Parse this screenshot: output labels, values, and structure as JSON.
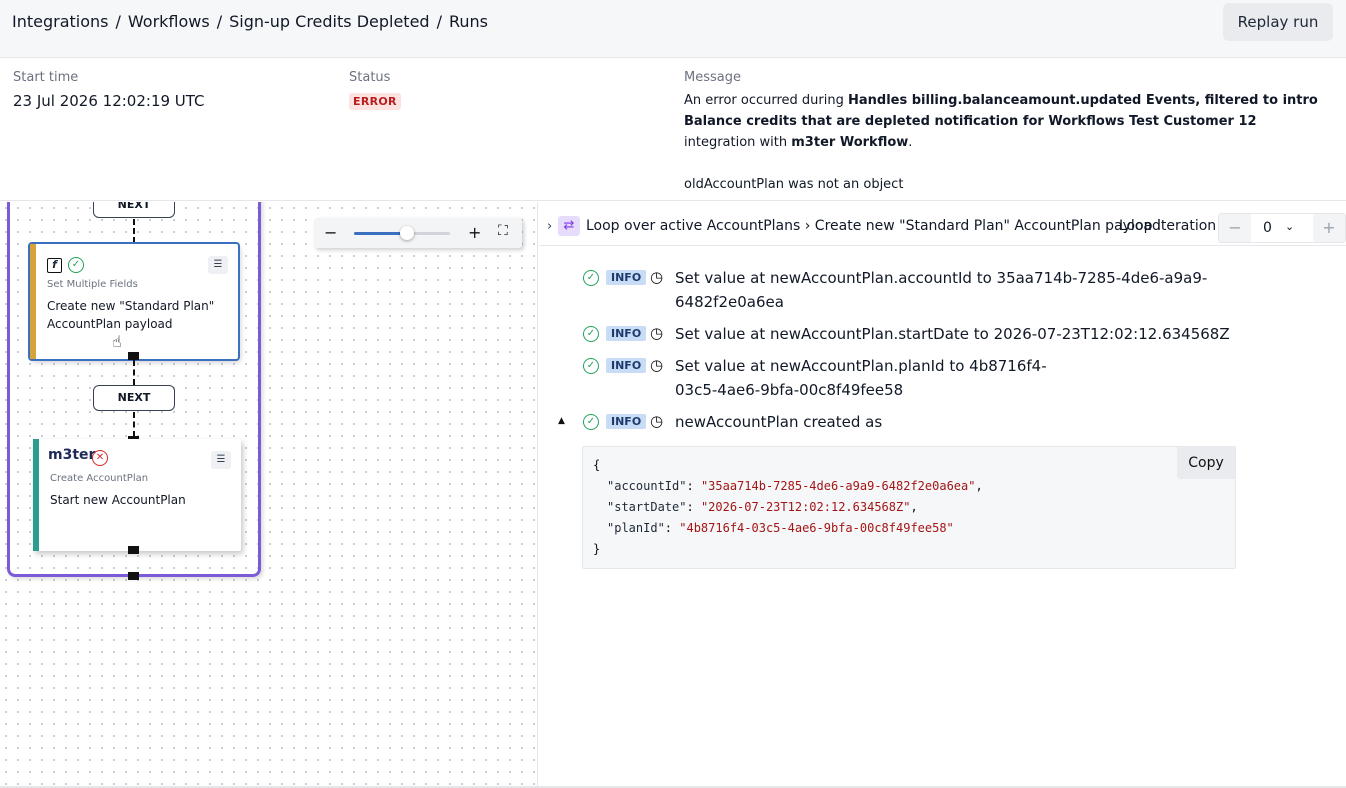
{
  "breadcrumb": [
    "Integrations",
    "Workflows",
    "Sign-up Credits Depleted",
    "Runs"
  ],
  "breadcrumb_sep": "/",
  "header": {
    "replay_label": "Replay run"
  },
  "run": {
    "start_label": "Start time",
    "start_value": "23 Jul 2026 12:02:19 UTC",
    "status_label": "Status",
    "status_value": "ERROR",
    "message_label": "Message",
    "message_prefix": "An error occurred during ",
    "message_event": "Handles billing.balanceamount.updated Events, filtered to intro Balance credits that are depleted notification for Workflows Test Customer 12",
    "message_mid": " integration with ",
    "message_target": "m3ter Workflow",
    "message_end": ".",
    "message_detail": "oldAccountPlan was not an object"
  },
  "canvas": {
    "next_label": "NEXT",
    "node1": {
      "sub": "Set Multiple Fields",
      "title": "Create new \"Standard Plan\" AccountPlan payload",
      "stripe": "#d6a23a"
    },
    "node2": {
      "logo": "m3ter",
      "sub": "Create AccountPlan",
      "title": "Start new AccountPlan",
      "stripe": "#2a9d8f"
    },
    "zoom_level": 0.55,
    "colors": {
      "loop_frame": "#7c5cd6",
      "accent": "#3b6fbf",
      "ok": "#22a35a",
      "error": "#dc2626"
    }
  },
  "log": {
    "path": "Loop over active AccountPlans › Create new \"Standard Plan\" AccountPlan payload",
    "iter_label": "Loop iteration",
    "iter_value": "0",
    "badge": "INFO",
    "entries": [
      {
        "text": "Set value at newAccountPlan.accountId to 35aa714b-7285-4de6-a9a9-6482f2e0a6ea"
      },
      {
        "text": "Set value at newAccountPlan.startDate to 2026-07-23T12:02:12.634568Z"
      },
      {
        "text": "Set value at newAccountPlan.planId to 4b8716f4-03c5-4ae6-9bfa-00c8f49fee58"
      },
      {
        "text": "newAccountPlan created as"
      }
    ],
    "copy_label": "Copy",
    "json": {
      "open": "{",
      "close": "}",
      "k1": "\"accountId\"",
      "v1": "\"35aa714b-7285-4de6-a9a9-6482f2e0a6ea\"",
      "k2": "\"startDate\"",
      "v2": "\"2026-07-23T12:02:12.634568Z\"",
      "k3": "\"planId\"",
      "v3": "\"4b8716f4-03c5-4ae6-9bfa-00c8f49fee58\""
    }
  }
}
